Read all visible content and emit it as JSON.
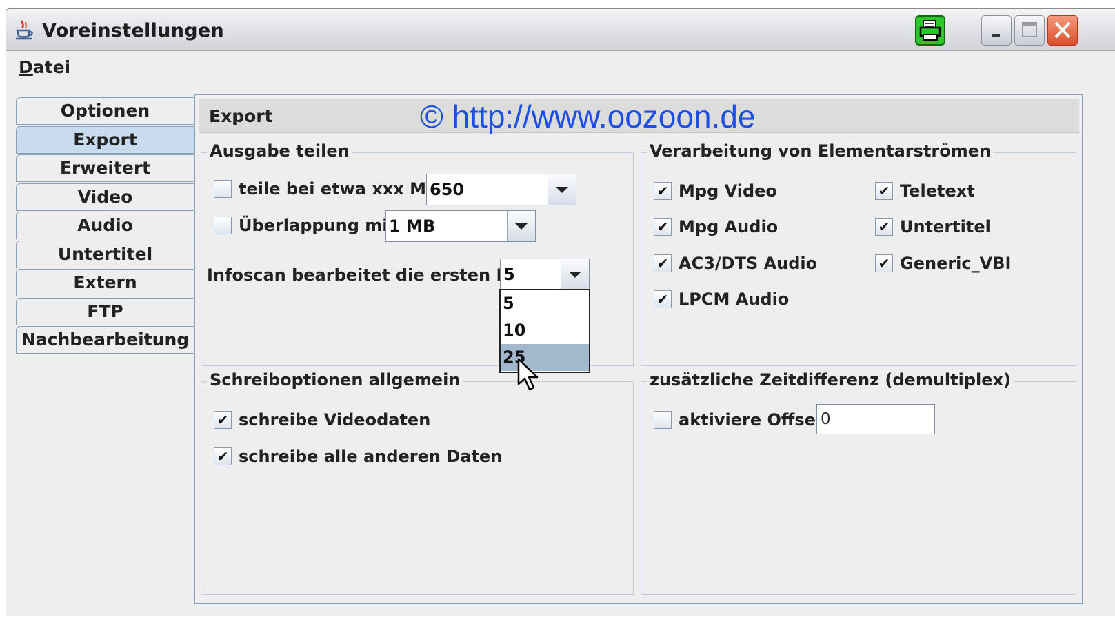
{
  "window": {
    "title": "Voreinstellungen"
  },
  "menu": {
    "items": [
      {
        "label_mnemonic": "D",
        "label_rest": "atei"
      }
    ]
  },
  "tabs": [
    {
      "label": "Optionen",
      "active": false
    },
    {
      "label": "Export",
      "active": true
    },
    {
      "label": "Erweitert",
      "active": false
    },
    {
      "label": "Video",
      "active": false
    },
    {
      "label": "Audio",
      "active": false
    },
    {
      "label": "Untertitel",
      "active": false
    },
    {
      "label": "Extern",
      "active": false
    },
    {
      "label": "FTP",
      "active": false
    },
    {
      "label": "Nachbearbeitung",
      "active": false
    }
  ],
  "panel": {
    "title": "Export",
    "watermark": "© http://www.oozoon.de"
  },
  "ausgabe": {
    "title": "Ausgabe teilen",
    "split_label": "teile bei etwa xxx MB",
    "split_checked": false,
    "split_value": "650",
    "overlap_label": "Überlappung mit",
    "overlap_checked": false,
    "overlap_value": "1 MB",
    "infoscan_label": "Infoscan bearbeitet die ersten MB:",
    "infoscan_value": "5",
    "infoscan_options": [
      "5",
      "10",
      "25"
    ],
    "infoscan_highlighted": "25"
  },
  "elementar": {
    "title": "Verarbeitung von Elementarströmen",
    "items": [
      {
        "label": "Mpg Video",
        "checked": true
      },
      {
        "label": "Teletext",
        "checked": true
      },
      {
        "label": "Mpg Audio",
        "checked": true
      },
      {
        "label": "Untertitel",
        "checked": true
      },
      {
        "label": "AC3/DTS Audio",
        "checked": true
      },
      {
        "label": "Generic_VBI",
        "checked": true
      },
      {
        "label": "LPCM Audio",
        "checked": true
      }
    ]
  },
  "schreib": {
    "title": "Schreiboptionen allgemein",
    "items": [
      {
        "label": "schreibe Videodaten",
        "checked": true
      },
      {
        "label": "schreibe alle anderen Daten",
        "checked": true
      }
    ]
  },
  "zeit": {
    "title": "zusätzliche Zeitdifferenz (demultiplex)",
    "offset_label": "aktiviere Offset",
    "offset_checked": false,
    "offset_value": "0"
  },
  "checkmark": "✔",
  "colors": {
    "watermark": "#1c4fe6",
    "active_tab": "#c9dbef",
    "highlight": "#a3b8cc"
  }
}
